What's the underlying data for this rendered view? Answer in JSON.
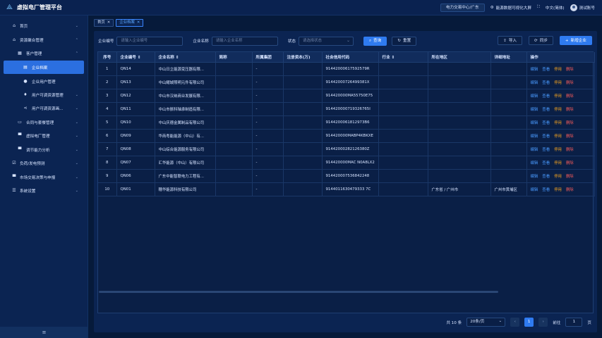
{
  "app": {
    "title": "虚拟电厂管理平台"
  },
  "header": {
    "tenant": "电力交易中心/广东",
    "energy_label": "能源数据可视化大屏",
    "lang": "中文(简体)",
    "user": "测试账号"
  },
  "sidebar": {
    "items": [
      {
        "label": "首页",
        "icon": "home-icon"
      },
      {
        "label": "资源聚合管理",
        "icon": "home-icon"
      },
      {
        "label": "客户管理",
        "icon": "grid-icon"
      },
      {
        "label": "企业档案",
        "icon": "file-icon"
      },
      {
        "label": "企业用户管理",
        "icon": "user-icon"
      },
      {
        "label": "用户可调资源管理",
        "icon": "bulb-icon"
      },
      {
        "label": "用户可调资源画...",
        "icon": "share-icon"
      },
      {
        "label": "合同与套餐管理",
        "icon": "doc-icon"
      },
      {
        "label": "虚拟电厂管理",
        "icon": "monitor-icon"
      },
      {
        "label": "调节能力分析",
        "icon": "monitor-icon"
      },
      {
        "label": "负荷/发电预测",
        "icon": "check-icon"
      },
      {
        "label": "市场交易决策与申报",
        "icon": "monitor-icon"
      },
      {
        "label": "系统设置",
        "icon": "sliders-icon"
      }
    ],
    "collapse": "≡"
  },
  "tabs": [
    {
      "label": "首页"
    },
    {
      "label": "企业档案"
    }
  ],
  "filters": {
    "code_label": "企业编号",
    "code_placeholder": "请输入企业编号",
    "name_label": "企业名称",
    "name_placeholder": "请输入企业名称",
    "status_label": "状态",
    "status_placeholder": "请选择状态",
    "search": "查询",
    "reset": "重置"
  },
  "actions": {
    "import": "导入",
    "sync": "同步",
    "add": "新增企业"
  },
  "table": {
    "columns": [
      "序号",
      "企业编号",
      "企业名称",
      "简称",
      "所属集团",
      "注册资本(万)",
      "社会信用代码",
      "行业",
      "所在地区",
      "详细地址",
      "操作"
    ],
    "row_actions": {
      "edit": "编辑",
      "view": "查看",
      "stop": "停用",
      "del": "删除"
    },
    "rows": [
      {
        "no": "1",
        "code": "QN14",
        "name": "中山日立能源变压器有限...",
        "short": "",
        "group": "-",
        "capital": "",
        "credit": "91442000617592579R",
        "industry": "",
        "region": "",
        "address": ""
      },
      {
        "no": "2",
        "code": "QN13",
        "name": "中山耀城照明元件有限公司",
        "short": "",
        "group": "-",
        "capital": "",
        "credit": "91442000726499381X",
        "industry": "",
        "region": "",
        "address": ""
      },
      {
        "no": "3",
        "code": "QN12",
        "name": "中山市汉纳商业发展有限...",
        "short": "",
        "group": "-",
        "capital": "",
        "credit": "914420000MA55750E75",
        "industry": "",
        "region": "",
        "address": ""
      },
      {
        "no": "4",
        "code": "QN11",
        "name": "中山市振科轴承制造有限...",
        "short": "",
        "group": "-",
        "capital": "",
        "credit": "914420000719326765I",
        "industry": "",
        "region": "",
        "address": ""
      },
      {
        "no": "5",
        "code": "QN10",
        "name": "中山庆德金属制品有限公司",
        "short": "",
        "group": "-",
        "capital": "",
        "credit": "9144200061812973B6",
        "industry": "",
        "region": "",
        "address": ""
      },
      {
        "no": "6",
        "code": "QN09",
        "name": "华商粤能能源（中山）有...",
        "short": "",
        "group": "-",
        "capital": "",
        "credit": "914420000MABP4KBKXE",
        "industry": "",
        "region": "",
        "address": ""
      },
      {
        "no": "7",
        "code": "QN08",
        "name": "中山综合能源服务有限公司",
        "short": "",
        "group": "-",
        "capital": "",
        "credit": "91442000282126380Z",
        "industry": "",
        "region": "",
        "address": ""
      },
      {
        "no": "8",
        "code": "QN07",
        "name": "汇华能源（中山）有限公司",
        "short": "",
        "group": "-",
        "capital": "",
        "credit": "914420000MAC N0A8LX2",
        "industry": "",
        "region": "",
        "address": ""
      },
      {
        "no": "9",
        "code": "QN06",
        "name": "广东中能智联电力工程有...",
        "short": "",
        "group": "-",
        "capital": "",
        "credit": "914420007536842248",
        "industry": "",
        "region": "",
        "address": ""
      },
      {
        "no": "10",
        "code": "QN01",
        "name": "穗华能源科技有限公司",
        "short": "",
        "group": "-",
        "capital": "",
        "credit": "9144011630479333 7C",
        "industry": "",
        "region": "广东省 / 广州市",
        "address": "广州市黄埔区"
      }
    ]
  },
  "pagination": {
    "total": "共 10 条",
    "page_size": "20条/页",
    "prev": "‹",
    "current": "1",
    "next": "›",
    "goto_label": "前往",
    "goto_value": "1",
    "page_unit": "页"
  }
}
